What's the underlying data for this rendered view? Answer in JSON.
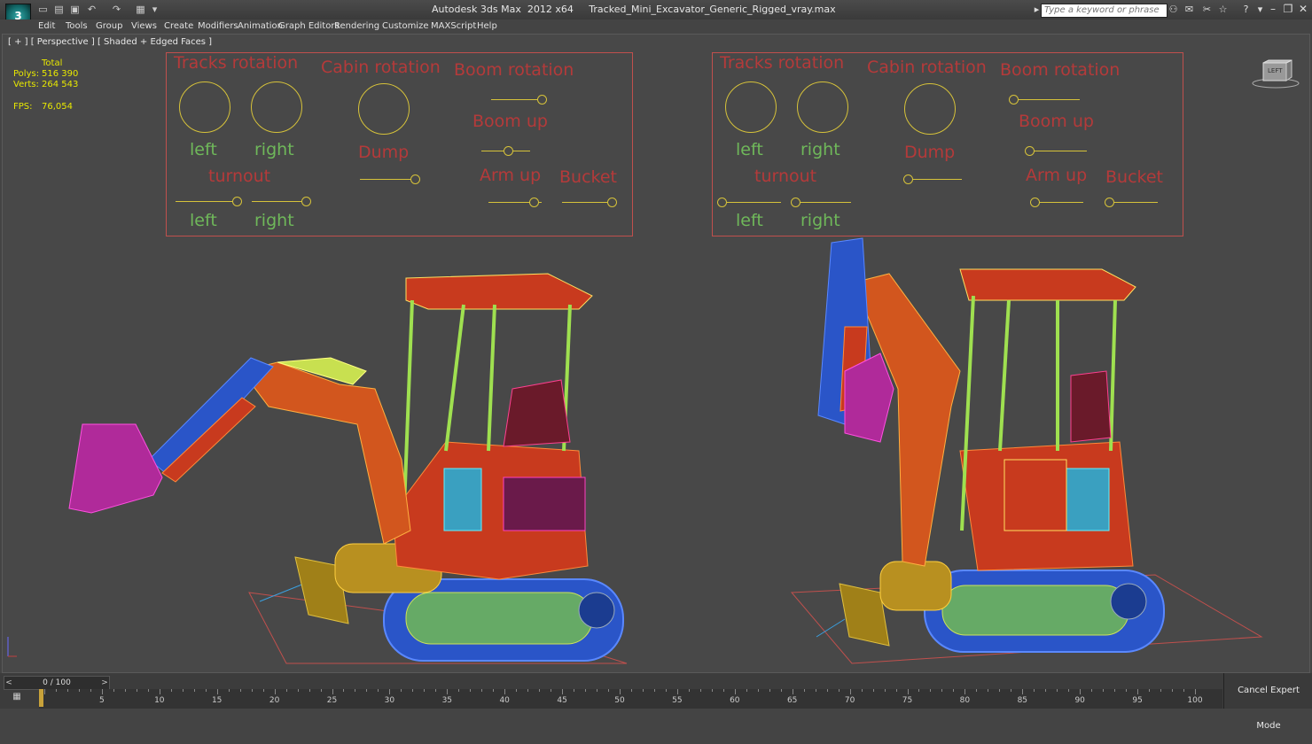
{
  "titlebar": {
    "app_logo": "3",
    "title": "Autodesk 3ds Max  2012 x64     Tracked_Mini_Excavator_Generic_Rigged_vray.max",
    "search_placeholder": "Type a keyword or phrase",
    "quick_access": [
      "new-icon",
      "open-icon",
      "save-icon",
      "undo-icon",
      "redo-icon",
      "project-icon"
    ],
    "right_icons": [
      "binoculars-icon",
      "star-icon",
      "help-icon"
    ],
    "window_buttons": {
      "minimize": "–",
      "restore": "❐",
      "close": "✕"
    }
  },
  "menu": [
    "Edit",
    "Tools",
    "Group",
    "Views",
    "Create",
    "Modifiers",
    "Animation",
    "Graph Editors",
    "Rendering",
    "Customize",
    "MAXScript",
    "Help"
  ],
  "viewport": {
    "label": "[ + ] [ Perspective ] [ Shaded + Edged Faces ]",
    "stats": {
      "total_label": "Total",
      "polys_label": "Polys:",
      "polys": "516 390",
      "verts_label": "Verts:",
      "verts": "264 543",
      "fps_label": "FPS:",
      "fps": "76,054"
    },
    "viewcube_label": "LEFT"
  },
  "control_panel": {
    "tracks_rotation": "Tracks rotation",
    "cabin_rotation": "Cabin rotation",
    "boom_rotation": "Boom rotation",
    "left": "left",
    "right": "right",
    "turnout": "turnout",
    "dump": "Dump",
    "boom_up": "Boom up",
    "arm_up": "Arm  up",
    "bucket": "Bucket"
  },
  "timebar": {
    "slider_label": "0 / 100",
    "ticks": [
      "5",
      "10",
      "15",
      "20",
      "25",
      "30",
      "35",
      "40",
      "45",
      "50",
      "55",
      "60",
      "65",
      "70",
      "75",
      "80",
      "85",
      "90",
      "95",
      "100"
    ],
    "cancel_expert": "Cancel Expert Mode"
  },
  "colors": {
    "panel_border": "#c0504d",
    "label_red": "#b43a3a",
    "label_green": "#6fb85a",
    "dial": "#d6c23a",
    "viewport_bg": "#484848"
  }
}
